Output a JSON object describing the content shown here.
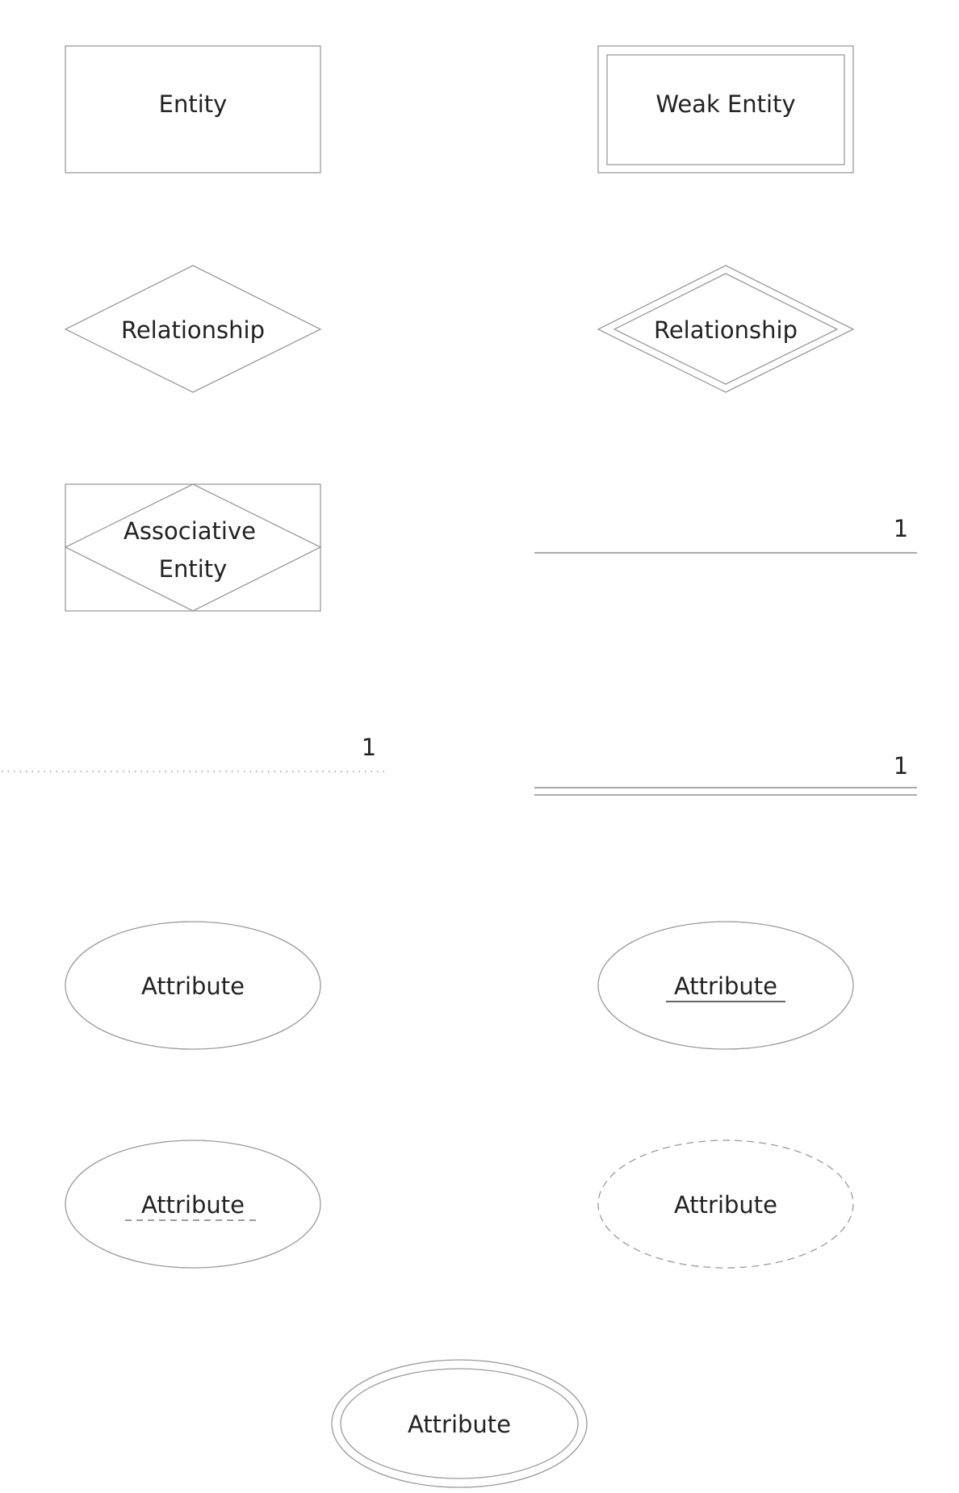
{
  "shapes": {
    "entity": "Entity",
    "weak_entity": "Weak Entity",
    "relationship": "Relationship",
    "identifying_relationship": "Relationship",
    "associative_entity": {
      "line1": "Associative",
      "line2": "Entity"
    },
    "attribute": "Attribute",
    "key_attribute": "Attribute",
    "partial_key_attribute": "Attribute",
    "derived_attribute": "Attribute",
    "multivalued_attribute": "Attribute"
  },
  "connectors": {
    "optional": {
      "cardinality": "1",
      "style": "dotted"
    },
    "single": {
      "cardinality": "1",
      "style": "solid"
    },
    "total": {
      "cardinality": "1",
      "style": "double"
    }
  },
  "colors": {
    "stroke": "#9a9a9a",
    "text": "#222222",
    "background": "#ffffff"
  }
}
